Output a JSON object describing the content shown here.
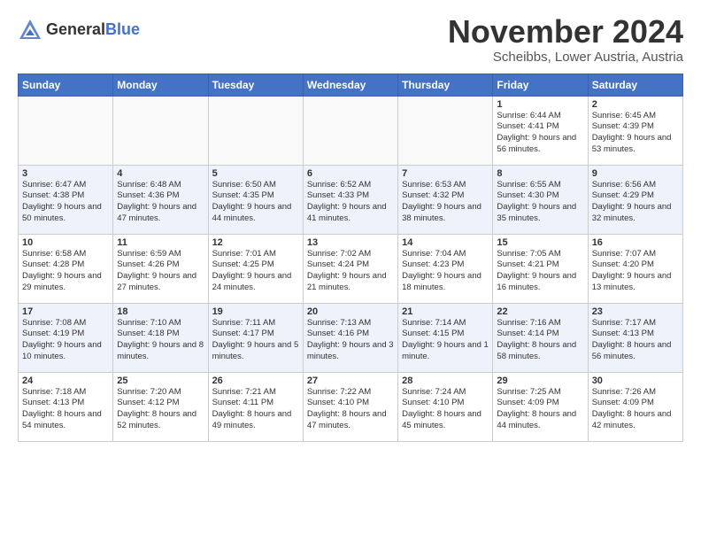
{
  "header": {
    "logo_general": "General",
    "logo_blue": "Blue",
    "month_title": "November 2024",
    "location": "Scheibbs, Lower Austria, Austria"
  },
  "weekdays": [
    "Sunday",
    "Monday",
    "Tuesday",
    "Wednesday",
    "Thursday",
    "Friday",
    "Saturday"
  ],
  "weeks": [
    [
      {
        "day": "",
        "info": ""
      },
      {
        "day": "",
        "info": ""
      },
      {
        "day": "",
        "info": ""
      },
      {
        "day": "",
        "info": ""
      },
      {
        "day": "",
        "info": ""
      },
      {
        "day": "1",
        "info": "Sunrise: 6:44 AM\nSunset: 4:41 PM\nDaylight: 9 hours and 56 minutes."
      },
      {
        "day": "2",
        "info": "Sunrise: 6:45 AM\nSunset: 4:39 PM\nDaylight: 9 hours and 53 minutes."
      }
    ],
    [
      {
        "day": "3",
        "info": "Sunrise: 6:47 AM\nSunset: 4:38 PM\nDaylight: 9 hours and 50 minutes."
      },
      {
        "day": "4",
        "info": "Sunrise: 6:48 AM\nSunset: 4:36 PM\nDaylight: 9 hours and 47 minutes."
      },
      {
        "day": "5",
        "info": "Sunrise: 6:50 AM\nSunset: 4:35 PM\nDaylight: 9 hours and 44 minutes."
      },
      {
        "day": "6",
        "info": "Sunrise: 6:52 AM\nSunset: 4:33 PM\nDaylight: 9 hours and 41 minutes."
      },
      {
        "day": "7",
        "info": "Sunrise: 6:53 AM\nSunset: 4:32 PM\nDaylight: 9 hours and 38 minutes."
      },
      {
        "day": "8",
        "info": "Sunrise: 6:55 AM\nSunset: 4:30 PM\nDaylight: 9 hours and 35 minutes."
      },
      {
        "day": "9",
        "info": "Sunrise: 6:56 AM\nSunset: 4:29 PM\nDaylight: 9 hours and 32 minutes."
      }
    ],
    [
      {
        "day": "10",
        "info": "Sunrise: 6:58 AM\nSunset: 4:28 PM\nDaylight: 9 hours and 29 minutes."
      },
      {
        "day": "11",
        "info": "Sunrise: 6:59 AM\nSunset: 4:26 PM\nDaylight: 9 hours and 27 minutes."
      },
      {
        "day": "12",
        "info": "Sunrise: 7:01 AM\nSunset: 4:25 PM\nDaylight: 9 hours and 24 minutes."
      },
      {
        "day": "13",
        "info": "Sunrise: 7:02 AM\nSunset: 4:24 PM\nDaylight: 9 hours and 21 minutes."
      },
      {
        "day": "14",
        "info": "Sunrise: 7:04 AM\nSunset: 4:23 PM\nDaylight: 9 hours and 18 minutes."
      },
      {
        "day": "15",
        "info": "Sunrise: 7:05 AM\nSunset: 4:21 PM\nDaylight: 9 hours and 16 minutes."
      },
      {
        "day": "16",
        "info": "Sunrise: 7:07 AM\nSunset: 4:20 PM\nDaylight: 9 hours and 13 minutes."
      }
    ],
    [
      {
        "day": "17",
        "info": "Sunrise: 7:08 AM\nSunset: 4:19 PM\nDaylight: 9 hours and 10 minutes."
      },
      {
        "day": "18",
        "info": "Sunrise: 7:10 AM\nSunset: 4:18 PM\nDaylight: 9 hours and 8 minutes."
      },
      {
        "day": "19",
        "info": "Sunrise: 7:11 AM\nSunset: 4:17 PM\nDaylight: 9 hours and 5 minutes."
      },
      {
        "day": "20",
        "info": "Sunrise: 7:13 AM\nSunset: 4:16 PM\nDaylight: 9 hours and 3 minutes."
      },
      {
        "day": "21",
        "info": "Sunrise: 7:14 AM\nSunset: 4:15 PM\nDaylight: 9 hours and 1 minute."
      },
      {
        "day": "22",
        "info": "Sunrise: 7:16 AM\nSunset: 4:14 PM\nDaylight: 8 hours and 58 minutes."
      },
      {
        "day": "23",
        "info": "Sunrise: 7:17 AM\nSunset: 4:13 PM\nDaylight: 8 hours and 56 minutes."
      }
    ],
    [
      {
        "day": "24",
        "info": "Sunrise: 7:18 AM\nSunset: 4:13 PM\nDaylight: 8 hours and 54 minutes."
      },
      {
        "day": "25",
        "info": "Sunrise: 7:20 AM\nSunset: 4:12 PM\nDaylight: 8 hours and 52 minutes."
      },
      {
        "day": "26",
        "info": "Sunrise: 7:21 AM\nSunset: 4:11 PM\nDaylight: 8 hours and 49 minutes."
      },
      {
        "day": "27",
        "info": "Sunrise: 7:22 AM\nSunset: 4:10 PM\nDaylight: 8 hours and 47 minutes."
      },
      {
        "day": "28",
        "info": "Sunrise: 7:24 AM\nSunset: 4:10 PM\nDaylight: 8 hours and 45 minutes."
      },
      {
        "day": "29",
        "info": "Sunrise: 7:25 AM\nSunset: 4:09 PM\nDaylight: 8 hours and 44 minutes."
      },
      {
        "day": "30",
        "info": "Sunrise: 7:26 AM\nSunset: 4:09 PM\nDaylight: 8 hours and 42 minutes."
      }
    ]
  ]
}
